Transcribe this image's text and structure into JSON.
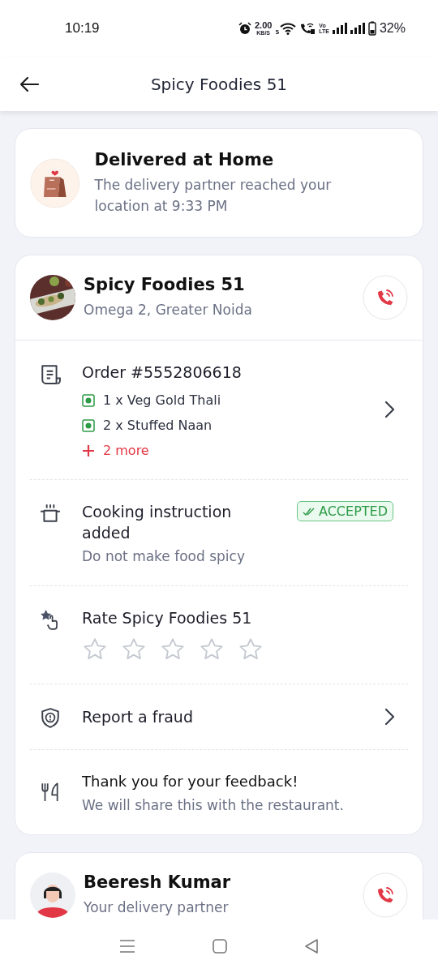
{
  "status_bar": {
    "time": "10:19",
    "net_speed": "2.00",
    "net_unit": "KB/S",
    "wifi_badge": "5",
    "volte_top": "Vo",
    "volte_bottom": "LTE",
    "battery": "32%"
  },
  "header": {
    "title": "Spicy Foodies 51"
  },
  "delivery_status": {
    "title": "Delivered at Home",
    "subtitle": "The delivery partner reached your location at 9:33 PM"
  },
  "restaurant": {
    "name": "Spicy Foodies 51",
    "address": "Omega 2, Greater Noida"
  },
  "sections": [
    {
      "kind": "order",
      "title": "Order #5552806618",
      "items": [
        {
          "text": "1 x Veg Gold Thali"
        },
        {
          "text": "2 x Stuffed Naan"
        }
      ],
      "more": "2 more"
    },
    {
      "kind": "instruction",
      "title": "Cooking instruction added",
      "badge": "ACCEPTED",
      "note": "Do not make food spicy"
    },
    {
      "kind": "rating",
      "title": "Rate Spicy Foodies 51",
      "stars": 0
    },
    {
      "kind": "fraud",
      "title": "Report a fraud"
    },
    {
      "kind": "feedback",
      "title": "Thank you for your feedback!",
      "note": "We will share this with the restaurant."
    }
  ],
  "delivery_partner": {
    "name": "Beeresh Kumar",
    "role": "Your delivery partner"
  }
}
